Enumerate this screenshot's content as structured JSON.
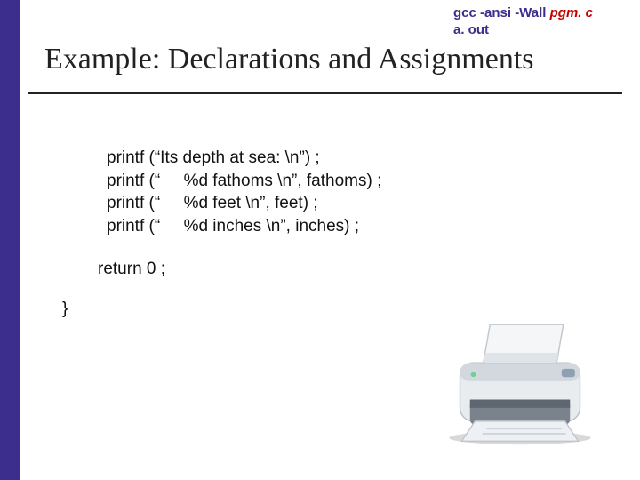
{
  "header": {
    "line1_base": "gcc  -ansi  -Wall ",
    "line1_file": "pgm. c",
    "line2_base": "a. out"
  },
  "title": "Example: Declarations and Assignments",
  "code": {
    "l1": "printf (“Its depth at sea: \\n”) ;",
    "l2": "printf (“     %d fathoms \\n”, fathoms) ;",
    "l3": "printf (“     %d feet \\n”, feet) ;",
    "l4": "printf (“     %d inches \\n”, inches) ;",
    "return": "return 0 ;",
    "brace": "}"
  }
}
